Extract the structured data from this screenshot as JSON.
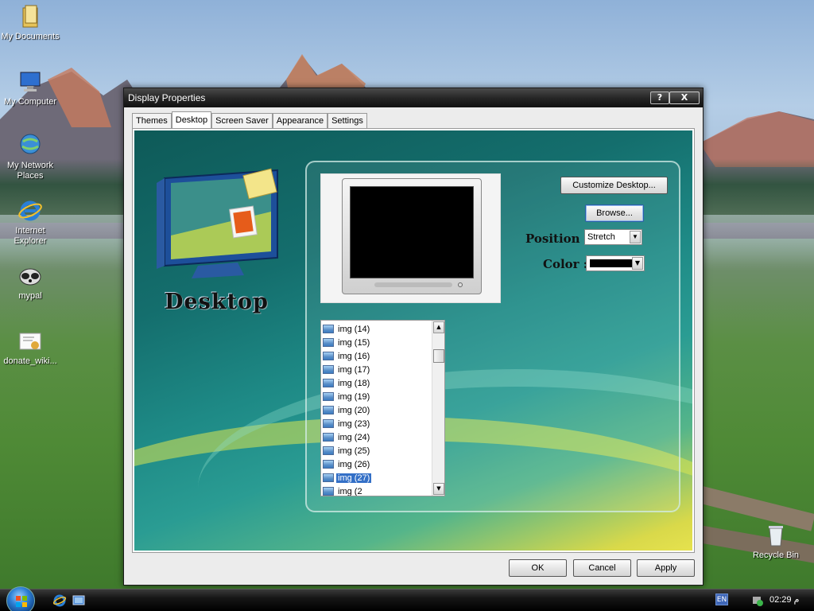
{
  "desktop": {
    "icons": [
      {
        "label": "My Documents"
      },
      {
        "label": "My Computer"
      },
      {
        "label": "My Network Places"
      },
      {
        "label": "Internet Explorer"
      },
      {
        "label": "mypal"
      },
      {
        "label": "donate_wiki..."
      }
    ],
    "recycle_bin": "Recycle Bin"
  },
  "window": {
    "title": "Display Properties",
    "help": "?",
    "close": "X",
    "tabs": [
      "Themes",
      "Desktop",
      "Screen Saver",
      "Appearance",
      "Settings"
    ],
    "active_tab": "Desktop"
  },
  "desktop_tab": {
    "heading": "Desktop",
    "customize_label": "Customize Desktop...",
    "browse_label": "Browse...",
    "position_label": "Position :",
    "position_value": "Stretch",
    "color_label": "Color :",
    "color_value": "#000000",
    "wallpapers": [
      "img (14)",
      "img (15)",
      "img (16)",
      "img (17)",
      "img (18)",
      "img (19)",
      "img (20)",
      "img (23)",
      "img (24)",
      "img (25)",
      "img (26)",
      "img (27)",
      "img (2"
    ],
    "selected_wallpaper": "img (27)"
  },
  "buttons": {
    "ok": "OK",
    "cancel": "Cancel",
    "apply": "Apply"
  },
  "taskbar": {
    "language": "EN",
    "clock": "02:29 م"
  }
}
